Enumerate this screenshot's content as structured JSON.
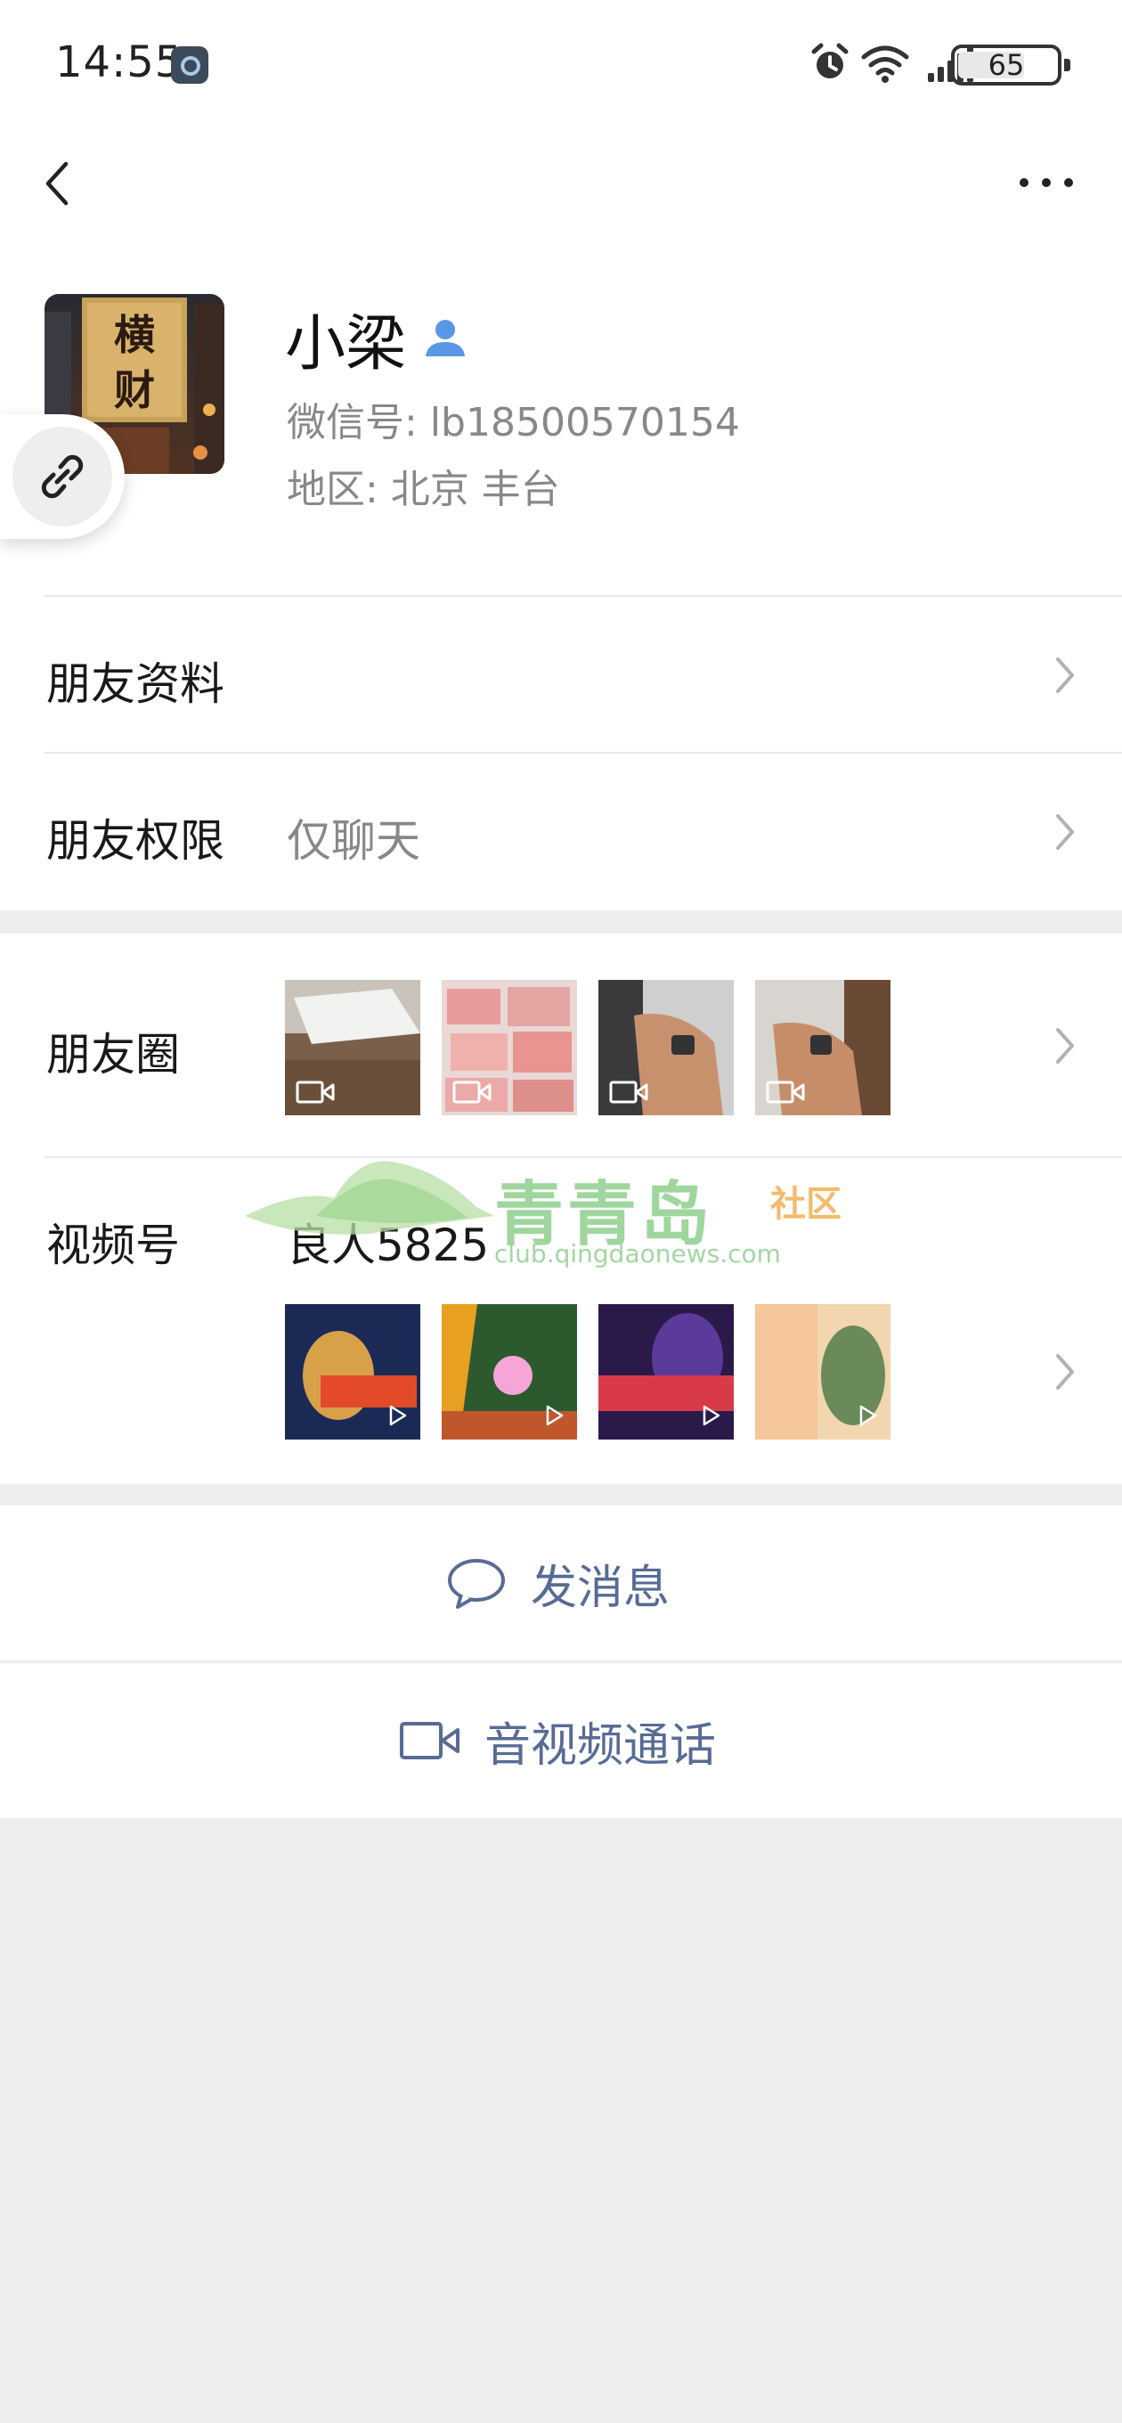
{
  "status_bar": {
    "time": "14:55",
    "battery": "65",
    "battery_level": 0.65,
    "icons": [
      "alarm-icon",
      "wifi-icon",
      "signal-icon",
      "battery-icon"
    ]
  },
  "nav": {
    "back_icon": "back-chevron-icon",
    "more_icon": "more-dots-icon"
  },
  "profile": {
    "nickname": "小梁",
    "wechat_id": "微信号:  lb18500570154",
    "region": "地区:  北京  丰台",
    "avatar_text": "横财"
  },
  "rows": {
    "friend_info": "朋友资料",
    "friend_permission": "朋友权限",
    "friend_permission_value": "仅聊天",
    "moments": "朋友圈",
    "channels": "视频号",
    "channels_name": "良人5825"
  },
  "actions": {
    "send_message": "发消息",
    "video_call": "音视频通话"
  },
  "watermark": {
    "title": "青青岛",
    "subtitle": "社区",
    "url": "club.qingdaonews.com"
  },
  "colors": {
    "link_blue": "#576b95",
    "verify_blue": "#4a90e2",
    "page_bg": "#ededed"
  }
}
